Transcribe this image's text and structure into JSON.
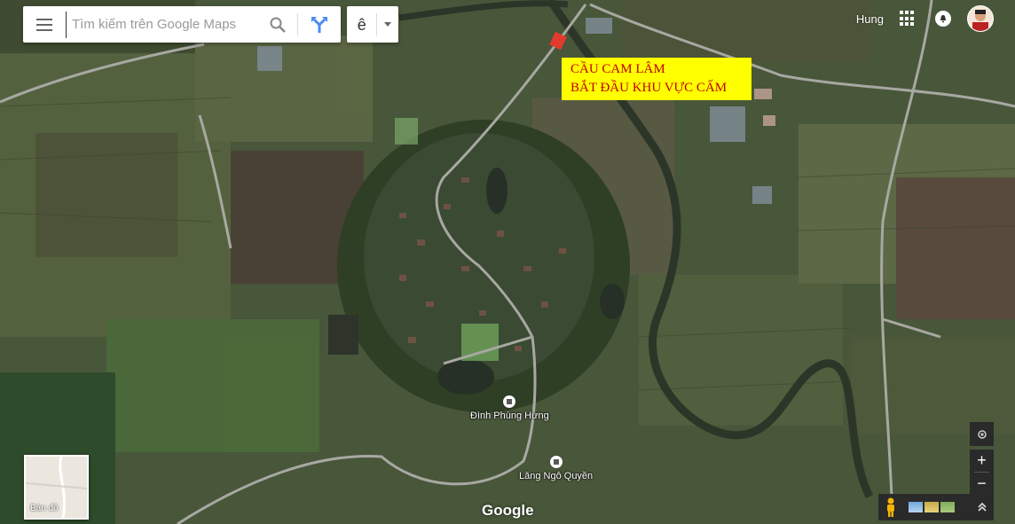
{
  "search": {
    "placeholder": "Tìm kiếm trên Google Maps"
  },
  "input_method": {
    "label": "ê"
  },
  "account": {
    "name": "Hung"
  },
  "annotation": {
    "line1": "CẦU CAM LÂM",
    "line2": "BẮT ĐẦU KHU VỰC CẤM"
  },
  "places": [
    {
      "name": "Đình Phùng Hưng"
    },
    {
      "name": "Lăng Ngô Quyền"
    }
  ],
  "basemap_toggle": {
    "label": "Bản đồ"
  },
  "logo": {
    "text": "Google"
  },
  "controls": {
    "zoom_in": "+",
    "zoom_out": "−"
  },
  "colors": {
    "annotation_bg": "#ffff00",
    "annotation_text": "#c00000",
    "bridge_marker": "#e23b2e"
  },
  "icons": [
    "menu-icon",
    "search-icon",
    "directions-icon",
    "apps-icon",
    "notifications-icon",
    "pegman-icon",
    "my-location-icon",
    "expand-icon"
  ]
}
